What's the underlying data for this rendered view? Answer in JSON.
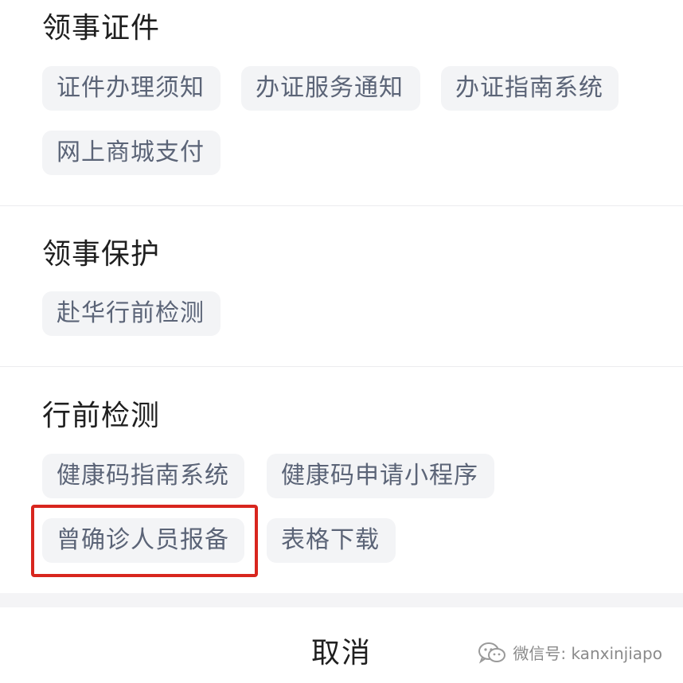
{
  "sections": [
    {
      "title": "领事证件",
      "chips": [
        "证件办理须知",
        "办证服务通知",
        "办证指南系统",
        "网上商城支付"
      ]
    },
    {
      "title": "领事保护",
      "chips": [
        "赴华行前检测"
      ]
    },
    {
      "title": "行前检测",
      "chips": [
        "健康码指南系统",
        "健康码申请小程序",
        "曾确诊人员报备",
        "表格下载"
      ]
    }
  ],
  "cancel_label": "取消",
  "watermark": {
    "text": "微信号: kanxinjiapo",
    "icon": "wechat-icon"
  },
  "colors": {
    "highlight": "#d8261e",
    "chip_bg": "#f3f4f6",
    "chip_text": "#5b6477",
    "title_text": "#1f1f1f"
  }
}
